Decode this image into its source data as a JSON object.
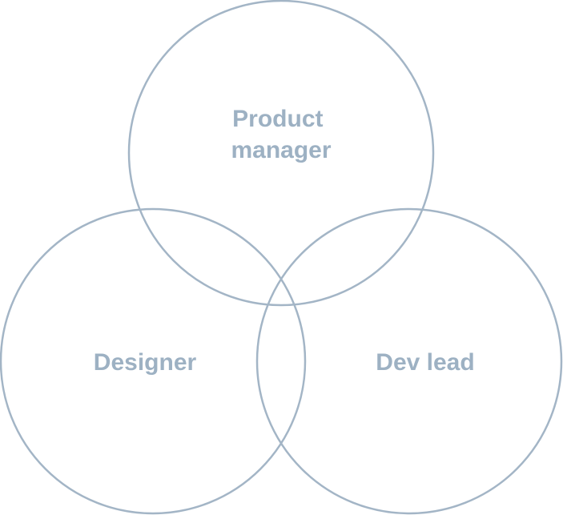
{
  "colors": {
    "circle_stroke": "#a3b5c6",
    "label_text": "#9db1c3",
    "background": "#ffffff"
  },
  "diagram": {
    "type": "venn",
    "sets": [
      {
        "id": "product-manager",
        "label_lines": [
          "Product",
          "manager"
        ]
      },
      {
        "id": "designer",
        "label_lines": [
          "Designer"
        ]
      },
      {
        "id": "dev-lead",
        "label_lines": [
          "Dev lead"
        ]
      }
    ]
  }
}
